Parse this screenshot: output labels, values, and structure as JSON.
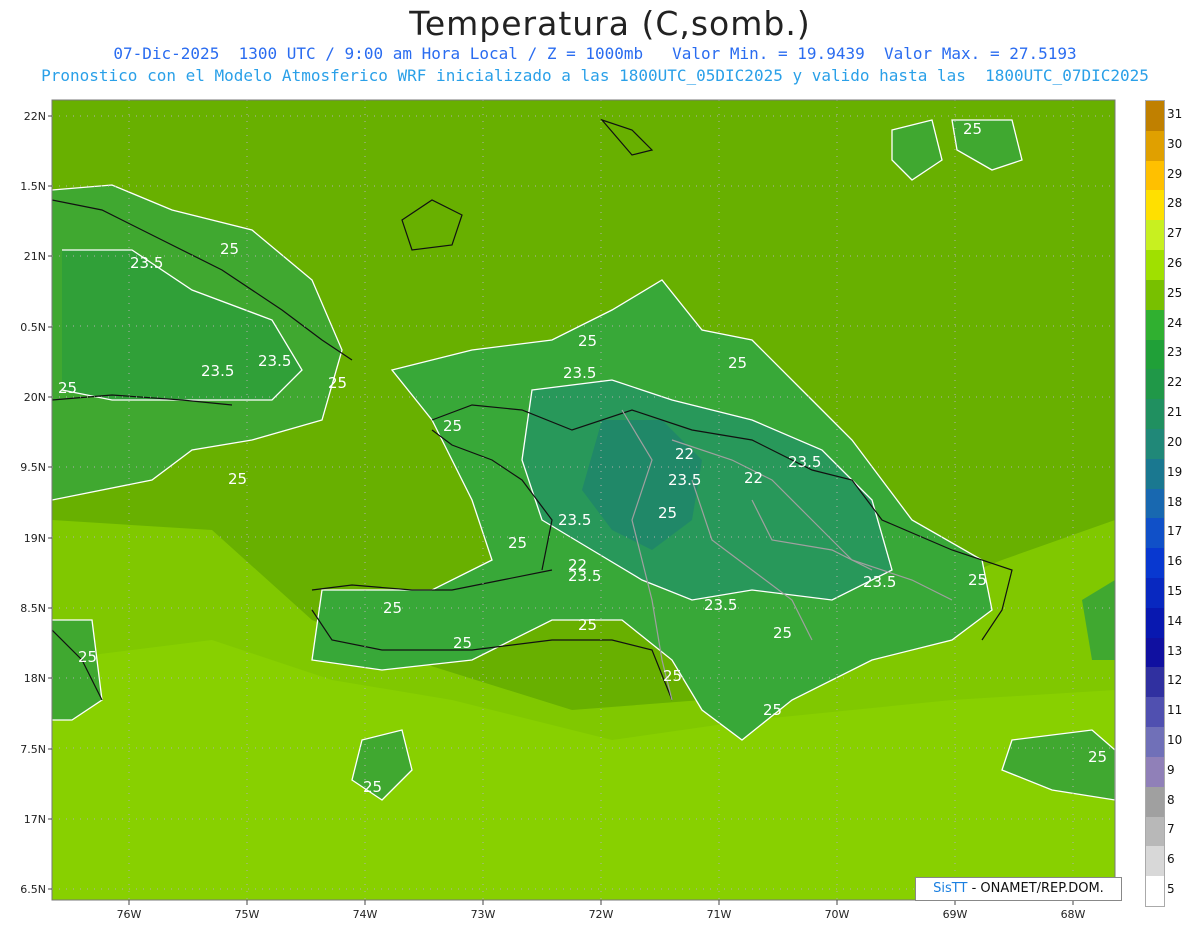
{
  "title": "Temperatura (C,somb.)",
  "subtitle_line1": "07-Dic-2025  1300 UTC / 9:00 am Hora Local / Z = 1000mb   Valor Min. = 19.9439  Valor Max. = 27.5193",
  "subtitle_line2": "Pronostico con el Modelo Atmosferico WRF inicializado a las 1800UTC_05DIC2025 y valido hasta las  1800UTC_07DIC2025",
  "credit": {
    "brand": "SisTT",
    "text": " - ONAMET/REP.DOM."
  },
  "lat_labels": [
    "22N",
    "1.5N",
    "21N",
    "0.5N",
    "20N",
    "9.5N",
    "19N",
    "8.5N",
    "18N",
    "7.5N",
    "17N",
    "6.5N"
  ],
  "lon_labels": [
    "76W",
    "75W",
    "74W",
    "73W",
    "72W",
    "71W",
    "70W",
    "69W",
    "68W"
  ],
  "colorbar": {
    "labels": [
      "31",
      "30",
      "29",
      "28",
      "27",
      "26",
      "25",
      "24",
      "23",
      "22",
      "21",
      "20",
      "19",
      "18",
      "17",
      "16",
      "15",
      "14",
      "13",
      "12",
      "11",
      "10",
      "9",
      "8",
      "7",
      "6",
      "5"
    ],
    "colors": [
      "#c08000",
      "#e0a000",
      "#ffc000",
      "#ffe000",
      "#c8f020",
      "#a0e000",
      "#78c000",
      "#30b030",
      "#20a038",
      "#209848",
      "#209060",
      "#208878",
      "#1a7890",
      "#1868b0",
      "#1050c8",
      "#0838d0",
      "#0828c0",
      "#0818b0",
      "#1010a0",
      "#3030a0",
      "#5050b0",
      "#7070b8",
      "#9080b8",
      "#a0a0a0",
      "#b8b8b8",
      "#d8d8d8",
      "#ffffff"
    ]
  },
  "contour_labels": [
    {
      "text": "25"
    },
    {
      "text": "25"
    },
    {
      "text": "23.5"
    },
    {
      "text": "23.5"
    },
    {
      "text": "23.5"
    },
    {
      "text": "25"
    },
    {
      "text": "25"
    },
    {
      "text": "25"
    },
    {
      "text": "25"
    },
    {
      "text": "23.5"
    },
    {
      "text": "25"
    },
    {
      "text": "25"
    },
    {
      "text": "22"
    },
    {
      "text": "23.5"
    },
    {
      "text": "23.5"
    },
    {
      "text": "22"
    },
    {
      "text": "23.5"
    },
    {
      "text": "25"
    },
    {
      "text": "25"
    },
    {
      "text": "22"
    },
    {
      "text": "23.5"
    },
    {
      "text": "23.5"
    },
    {
      "text": "25"
    },
    {
      "text": "25"
    },
    {
      "text": "25"
    },
    {
      "text": "25"
    },
    {
      "text": "25"
    },
    {
      "text": "25"
    },
    {
      "text": "25"
    },
    {
      "text": "25"
    },
    {
      "text": "25"
    },
    {
      "text": "25"
    },
    {
      "text": "23.5"
    }
  ]
}
